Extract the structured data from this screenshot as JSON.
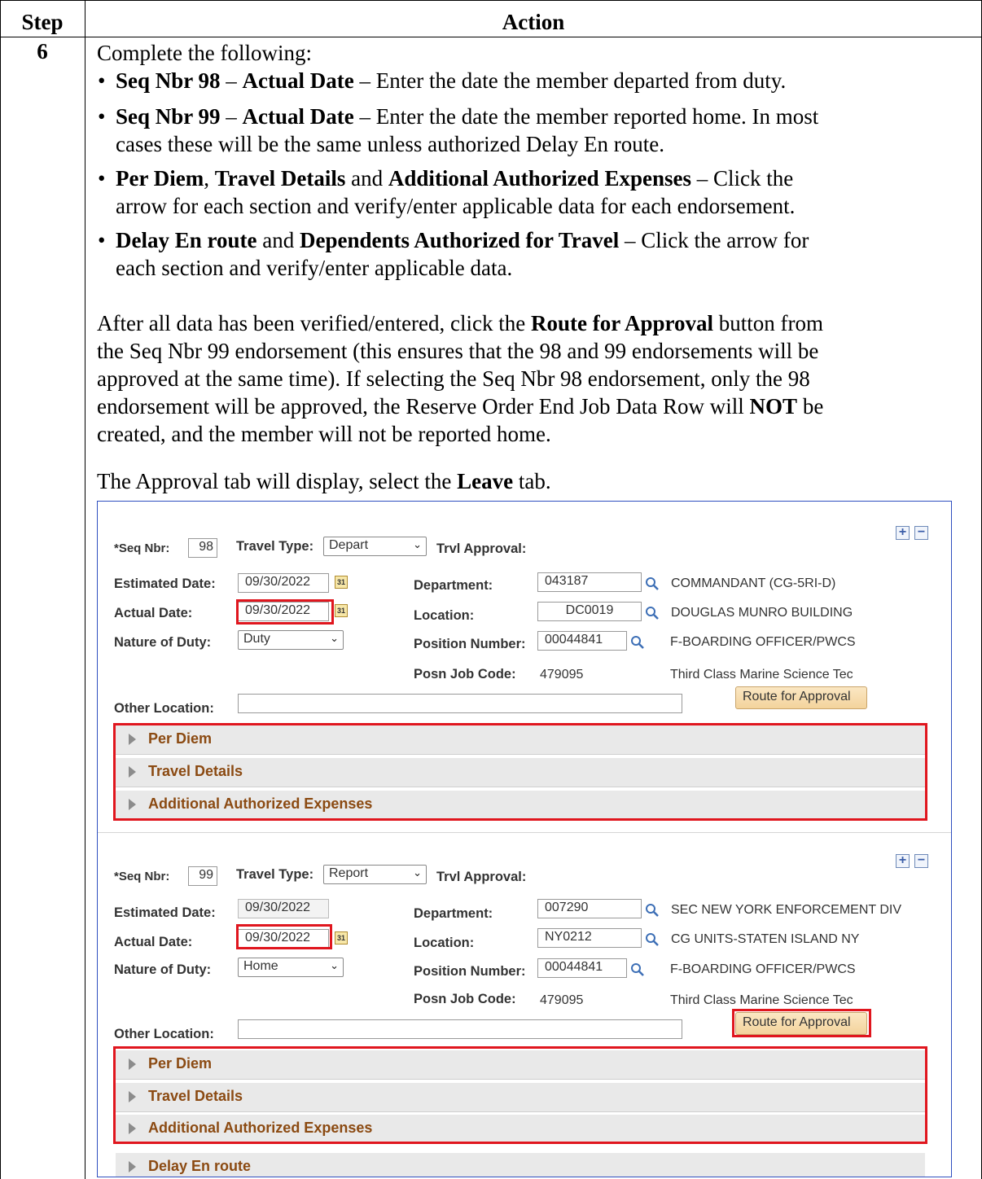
{
  "table": {
    "header_step": "Step",
    "header_action": "Action",
    "step_number": "6"
  },
  "instructions": {
    "intro": "Complete the following:",
    "bullets": [
      {
        "b1": "Seq Nbr 98",
        "t1": " – ",
        "b2": "Actual Date",
        "t2": " – Enter the date the member departed from duty."
      },
      {
        "b1": "Seq Nbr 99",
        "t1": " – ",
        "b2": "Actual Date",
        "t2": " – Enter the date the member reported home. In most",
        "cont": "cases these will be the same unless authorized Delay En route."
      },
      {
        "b1": "Per Diem",
        "t1": ", ",
        "b2": "Travel Details",
        "t2": " and ",
        "b3": "Additional Authorized Expenses",
        "t3": " – Click the",
        "cont": "arrow for each section and verify/enter applicable data for each endorsement."
      },
      {
        "b1": "Delay En route",
        "t1": " and ",
        "b2": "Dependents Authorized for Travel",
        "t2": " – Click the arrow for",
        "cont": "each section and verify/enter applicable data."
      }
    ],
    "para1": {
      "l1a": "After all data has been verified/entered, click the ",
      "l1b": "Route for Approval",
      "l1c": " button from",
      "l2": "the Seq Nbr 99 endorsement (this ensures that the 98 and 99 endorsements will be",
      "l3": "approved at the same time). If selecting the Seq Nbr 98 endorsement, only the 98",
      "l4a": "endorsement will be approved, the Reserve Order End Job Data Row will ",
      "l4b": "NOT",
      "l4c": " be",
      "l5": "created, and the member will not be reported home."
    },
    "para2": {
      "a": "The Approval tab will display, select the ",
      "b": "Leave",
      "c": " tab."
    }
  },
  "screenshot": {
    "labels": {
      "seq_nbr": "*Seq Nbr:",
      "travel_type": "Travel Type:",
      "trvl_approval": "Trvl Approval:",
      "estimated_date": "Estimated Date:",
      "actual_date": "Actual Date:",
      "nature_of_duty": "Nature of Duty:",
      "department": "Department:",
      "location": "Location:",
      "position_number": "Position Number:",
      "posn_job_code": "Posn Job Code:",
      "other_location": "Other Location:",
      "route_button": "Route for Approval",
      "plus": "+",
      "minus": "−"
    },
    "sections": [
      "Per Diem",
      "Travel Details",
      "Additional Authorized Expenses"
    ],
    "cal_glyph": "31",
    "endorsements": [
      {
        "seq_nbr": "98",
        "travel_type": "Depart",
        "estimated_date": "09/30/2022",
        "actual_date": "09/30/2022",
        "nature_of_duty": "Duty",
        "department_code": "043187",
        "department_name": "COMMANDANT (CG-5RI-D)",
        "location_code": "DC0019",
        "location_name": "DOUGLAS MUNRO BUILDING",
        "position_number": "00044841",
        "position_title": "F-BOARDING OFFICER/PWCS",
        "posn_job_code": "479095",
        "job_title": "Third Class Marine Science Tec",
        "other_location": ""
      },
      {
        "seq_nbr": "99",
        "travel_type": "Report",
        "estimated_date": "09/30/2022",
        "actual_date": "09/30/2022",
        "nature_of_duty": "Home",
        "department_code": "007290",
        "department_name": "SEC NEW YORK ENFORCEMENT DIV",
        "location_code": "NY0212",
        "location_name": "CG UNITS-STATEN ISLAND NY",
        "position_number": "00044841",
        "position_title": "F-BOARDING OFFICER/PWCS",
        "posn_job_code": "479095",
        "job_title": "Third Class Marine Science Tec",
        "other_location": ""
      }
    ],
    "cutoff_section": "Delay En route"
  }
}
